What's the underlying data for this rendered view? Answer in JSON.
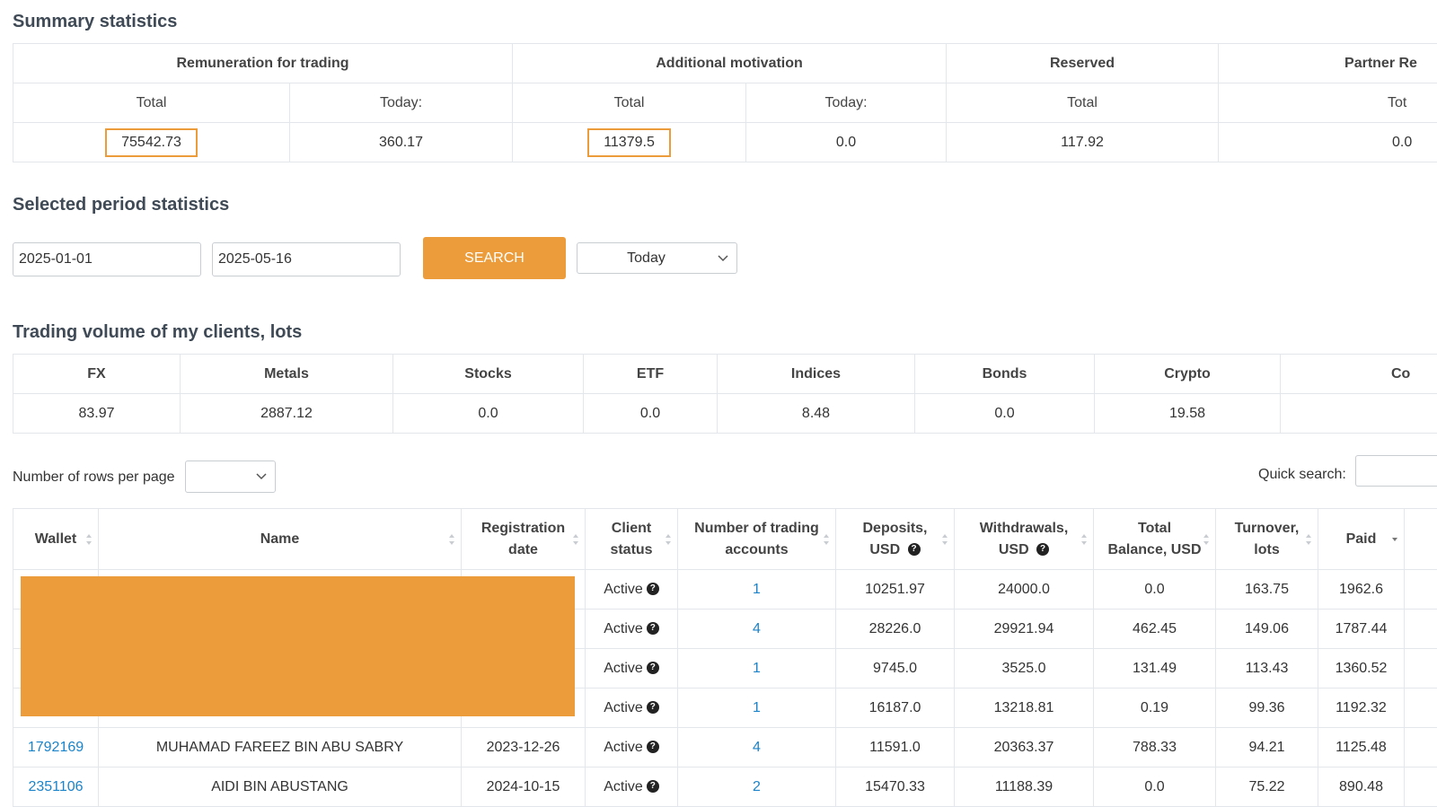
{
  "summary": {
    "title": "Summary statistics",
    "groups": [
      "Remuneration for trading",
      "Additional motivation",
      "Reserved",
      "Partner Re"
    ],
    "sub_headers": [
      "Total",
      "Today:",
      "Total",
      "Today:",
      "Total",
      "Tot"
    ],
    "values": [
      "75542.73",
      "360.17",
      "11379.5",
      "0.0",
      "117.92",
      "0.0"
    ]
  },
  "period": {
    "title": "Selected period statistics",
    "date_from": "2025-01-01",
    "date_to": "2025-05-16",
    "search_label": "SEARCH",
    "range_select": "Today"
  },
  "volume": {
    "title": "Trading volume of my clients, lots",
    "headers": [
      "FX",
      "Metals",
      "Stocks",
      "ETF",
      "Indices",
      "Bonds",
      "Crypto",
      "Co"
    ],
    "values": [
      "83.97",
      "2887.12",
      "0.0",
      "0.0",
      "8.48",
      "0.0",
      "19.58",
      ""
    ]
  },
  "controls": {
    "rows_per_page_label": "Number of rows per page",
    "rows_per_page_value": "",
    "quick_search_label": "Quick search:",
    "quick_search_value": ""
  },
  "clients": {
    "headers": [
      "Wallet",
      "Name",
      "Registration date",
      "Client status",
      "Number of trading accounts",
      "Deposits, USD",
      "Withdrawals, USD",
      "Total Balance, USD",
      "Turnover, lots",
      "Paid"
    ],
    "rows": [
      {
        "wallet": "",
        "name": "",
        "reg_date": "",
        "status": "Active",
        "accounts": "1",
        "deposits": "10251.97",
        "withdrawals": "24000.0",
        "balance": "0.0",
        "turnover": "163.75",
        "paid": "1962.6"
      },
      {
        "wallet": "",
        "name": "",
        "reg_date": "",
        "status": "Active",
        "accounts": "4",
        "deposits": "28226.0",
        "withdrawals": "29921.94",
        "balance": "462.45",
        "turnover": "149.06",
        "paid": "1787.44"
      },
      {
        "wallet": "",
        "name": "",
        "reg_date": "",
        "status": "Active",
        "accounts": "1",
        "deposits": "9745.0",
        "withdrawals": "3525.0",
        "balance": "131.49",
        "turnover": "113.43",
        "paid": "1360.52"
      },
      {
        "wallet": "",
        "name": "",
        "reg_date": "",
        "status": "Active",
        "accounts": "1",
        "deposits": "16187.0",
        "withdrawals": "13218.81",
        "balance": "0.19",
        "turnover": "99.36",
        "paid": "1192.32"
      },
      {
        "wallet": "1792169",
        "name": "MUHAMAD FAREEZ BIN ABU SABRY",
        "reg_date": "2023-12-26",
        "status": "Active",
        "accounts": "4",
        "deposits": "11591.0",
        "withdrawals": "20363.37",
        "balance": "788.33",
        "turnover": "94.21",
        "paid": "1125.48"
      },
      {
        "wallet": "2351106",
        "name": "AIDI BIN ABUSTANG",
        "reg_date": "2024-10-15",
        "status": "Active",
        "accounts": "2",
        "deposits": "15470.33",
        "withdrawals": "11188.39",
        "balance": "0.0",
        "turnover": "75.22",
        "paid": "890.48"
      }
    ]
  },
  "colors": {
    "accent": "#ec9c3a",
    "link": "#1b83c9",
    "border": "#e3e6ea",
    "heading": "#3f4a56"
  },
  "icons": [
    "chevron-down-icon",
    "sort-icon",
    "question-icon"
  ]
}
